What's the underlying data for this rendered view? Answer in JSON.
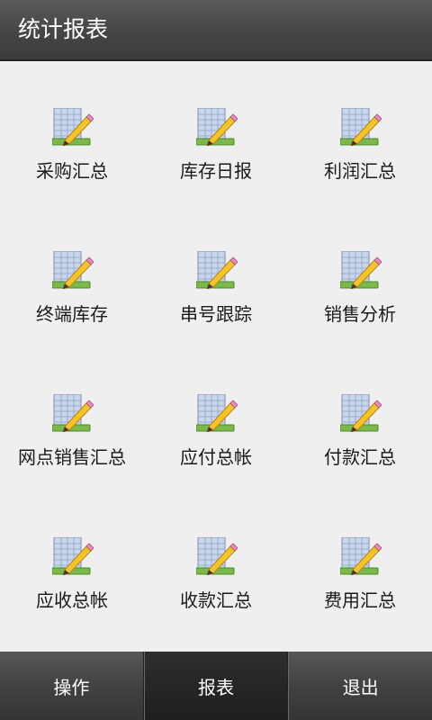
{
  "header": {
    "title": "统计报表"
  },
  "icon_name": "report-edit-icon",
  "items": [
    {
      "label": "采购汇总"
    },
    {
      "label": "库存日报"
    },
    {
      "label": "利润汇总"
    },
    {
      "label": "终端库存"
    },
    {
      "label": "串号跟踪"
    },
    {
      "label": "销售分析"
    },
    {
      "label": "网点销售汇总"
    },
    {
      "label": "应付总帐"
    },
    {
      "label": "付款汇总"
    },
    {
      "label": "应收总帐"
    },
    {
      "label": "收款汇总"
    },
    {
      "label": "费用汇总"
    }
  ],
  "tabs": [
    {
      "label": "操作",
      "active": false
    },
    {
      "label": "报表",
      "active": true
    },
    {
      "label": "退出",
      "active": false
    }
  ]
}
